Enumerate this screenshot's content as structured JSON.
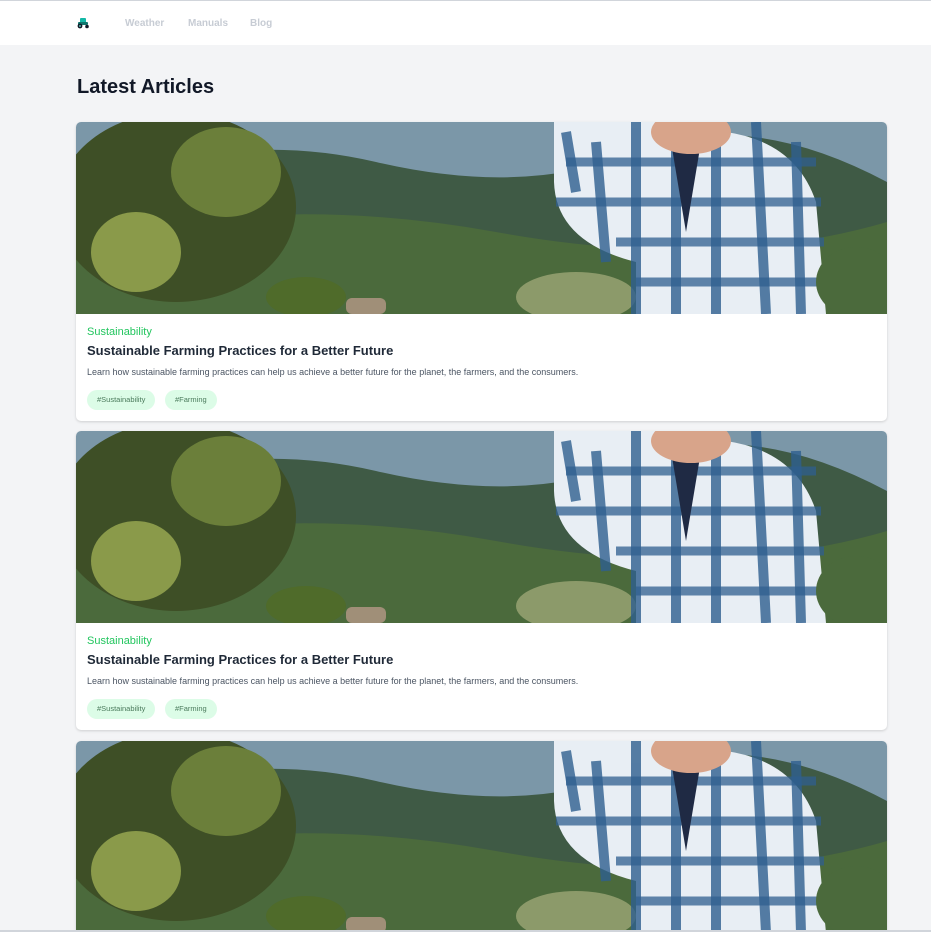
{
  "nav": {
    "logo_icon": "tractor-icon",
    "links": [
      "Weather",
      "Manuals",
      "Blog"
    ]
  },
  "page": {
    "title": "Latest Articles"
  },
  "articles": [
    {
      "category": "Sustainability",
      "title": "Sustainable Farming Practices for a Better Future",
      "excerpt": "Learn how sustainable farming practices can help us achieve a better future for the planet, the farmers, and the consumers.",
      "tags": [
        "#Sustainability",
        "#Farming"
      ]
    },
    {
      "category": "Sustainability",
      "title": "Sustainable Farming Practices for a Better Future",
      "excerpt": "Learn how sustainable farming practices can help us achieve a better future for the planet, the farmers, and the consumers.",
      "tags": [
        "#Sustainability",
        "#Farming"
      ]
    },
    {
      "category": "",
      "title": "",
      "excerpt": "",
      "tags": []
    }
  ],
  "colors": {
    "accent": "#22c55e",
    "tag_background": "#dcfce7",
    "page_background": "#f3f4f6",
    "nav_link": "#c7ccd4"
  }
}
